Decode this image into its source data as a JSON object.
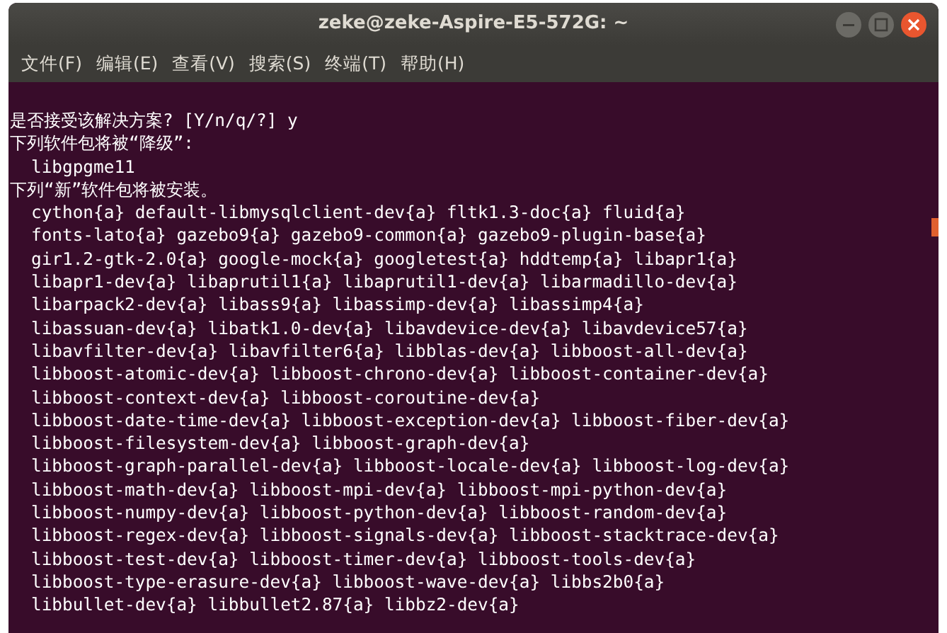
{
  "window": {
    "title": "zeke@zeke-Aspire-E5-572G: ~"
  },
  "menu": [
    "文件(F)",
    "编辑(E)",
    "查看(V)",
    "搜索(S)",
    "终端(T)",
    "帮助(H)"
  ],
  "terminal": {
    "lines": [
      {
        "kind": "text",
        "text": "是否接受该解决方案? [Y/n/q/?] y"
      },
      {
        "kind": "text",
        "text": "下列软件包将被“降级”:"
      },
      {
        "kind": "item",
        "text": "libgpgme11"
      },
      {
        "kind": "text",
        "text": "下列“新”软件包将被安装。"
      },
      {
        "kind": "item",
        "text": "cython{a} default-libmysqlclient-dev{a} fltk1.3-doc{a} fluid{a}"
      },
      {
        "kind": "item",
        "text": "fonts-lato{a} gazebo9{a} gazebo9-common{a} gazebo9-plugin-base{a}"
      },
      {
        "kind": "item",
        "text": "gir1.2-gtk-2.0{a} google-mock{a} googletest{a} hddtemp{a} libapr1{a}"
      },
      {
        "kind": "item",
        "text": "libapr1-dev{a} libaprutil1{a} libaprutil1-dev{a} libarmadillo-dev{a}"
      },
      {
        "kind": "item",
        "text": "libarpack2-dev{a} libass9{a} libassimp-dev{a} libassimp4{a}"
      },
      {
        "kind": "item",
        "text": "libassuan-dev{a} libatk1.0-dev{a} libavdevice-dev{a} libavdevice57{a}"
      },
      {
        "kind": "item",
        "text": "libavfilter-dev{a} libavfilter6{a} libblas-dev{a} libboost-all-dev{a}"
      },
      {
        "kind": "item",
        "text": "libboost-atomic-dev{a} libboost-chrono-dev{a} libboost-container-dev{a}"
      },
      {
        "kind": "item",
        "text": "libboost-context-dev{a} libboost-coroutine-dev{a}"
      },
      {
        "kind": "item",
        "text": "libboost-date-time-dev{a} libboost-exception-dev{a} libboost-fiber-dev{a}"
      },
      {
        "kind": "item",
        "text": "libboost-filesystem-dev{a} libboost-graph-dev{a}"
      },
      {
        "kind": "item",
        "text": "libboost-graph-parallel-dev{a} libboost-locale-dev{a} libboost-log-dev{a}"
      },
      {
        "kind": "item",
        "text": "libboost-math-dev{a} libboost-mpi-dev{a} libboost-mpi-python-dev{a}"
      },
      {
        "kind": "item",
        "text": "libboost-numpy-dev{a} libboost-python-dev{a} libboost-random-dev{a}"
      },
      {
        "kind": "item",
        "text": "libboost-regex-dev{a} libboost-signals-dev{a} libboost-stacktrace-dev{a}"
      },
      {
        "kind": "item",
        "text": "libboost-test-dev{a} libboost-timer-dev{a} libboost-tools-dev{a}"
      },
      {
        "kind": "item",
        "text": "libboost-type-erasure-dev{a} libboost-wave-dev{a} libbs2b0{a}"
      },
      {
        "kind": "item",
        "text": "libbullet-dev{a} libbullet2.87{a} libbz2-dev{a}"
      }
    ]
  }
}
